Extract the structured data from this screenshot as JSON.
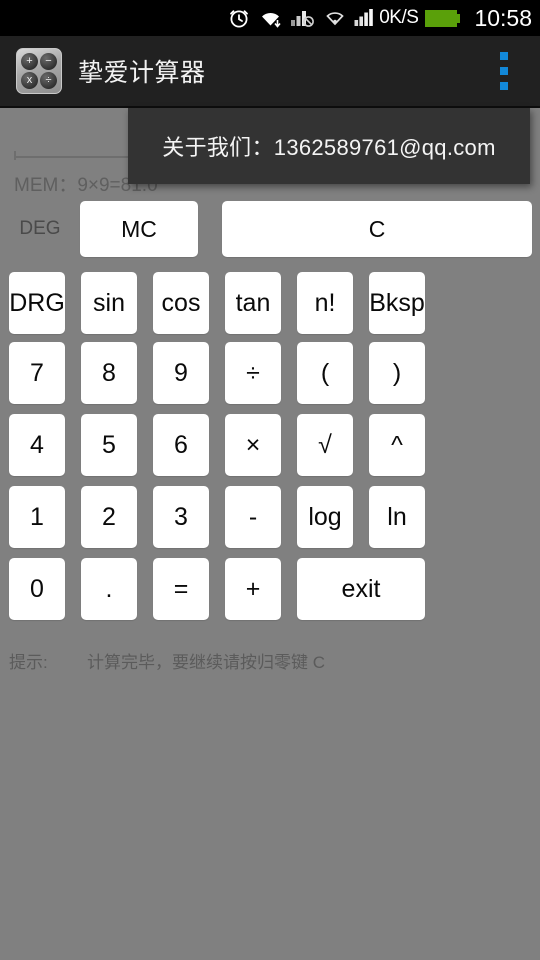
{
  "status_bar": {
    "icons": [
      "alarm-clock-icon",
      "wifi-icon",
      "signal-bars-no-sim-icon",
      "wifi-data-icon",
      "signal-bars-icon"
    ],
    "network_speed": "0K/S",
    "battery": "battery-full-icon",
    "battery_color": "#5aa00a",
    "time": "10:58"
  },
  "action_bar": {
    "app_icon": "calculator-app-icon",
    "icon_glyphs": [
      "+",
      "−",
      "x",
      "÷"
    ],
    "title": "挚爱计算器",
    "overflow": "overflow-menu-icon",
    "accent": "#1288d8"
  },
  "popup": {
    "text": "关于我们：1362589761@qq.com"
  },
  "display": {
    "value": "",
    "placeholder": "",
    "memory_line": "MEM：9×9=81.0"
  },
  "mode": {
    "angle_label": "DEG"
  },
  "top_keys": [
    {
      "label": "MC",
      "name": "memory-clear-button"
    },
    {
      "label": "C",
      "name": "clear-button"
    }
  ],
  "keypad": {
    "rows": [
      [
        {
          "label": "DRG",
          "name": "drg-button",
          "tall": true
        },
        {
          "label": "sin",
          "name": "sin-button"
        },
        {
          "label": "cos",
          "name": "cos-button"
        },
        {
          "label": "tan",
          "name": "tan-button"
        },
        {
          "label": "n!",
          "name": "factorial-button"
        },
        {
          "label": "Bksp",
          "name": "backspace-button",
          "tall": true
        }
      ],
      [
        {
          "label": "7",
          "name": "digit-7-button"
        },
        {
          "label": "8",
          "name": "digit-8-button"
        },
        {
          "label": "9",
          "name": "digit-9-button"
        },
        {
          "label": "÷",
          "name": "divide-button"
        },
        {
          "label": "(",
          "name": "open-paren-button"
        },
        {
          "label": ")",
          "name": "close-paren-button"
        }
      ],
      [
        {
          "label": "4",
          "name": "digit-4-button"
        },
        {
          "label": "5",
          "name": "digit-5-button"
        },
        {
          "label": "6",
          "name": "digit-6-button"
        },
        {
          "label": "×",
          "name": "multiply-button"
        },
        {
          "label": "√",
          "name": "sqrt-button"
        },
        {
          "label": "^",
          "name": "power-button"
        }
      ],
      [
        {
          "label": "1",
          "name": "digit-1-button"
        },
        {
          "label": "2",
          "name": "digit-2-button"
        },
        {
          "label": "3",
          "name": "digit-3-button"
        },
        {
          "label": "-",
          "name": "minus-button"
        },
        {
          "label": "log",
          "name": "log-button"
        },
        {
          "label": "ln",
          "name": "ln-button"
        }
      ],
      [
        {
          "label": "0",
          "name": "digit-0-button"
        },
        {
          "label": ".",
          "name": "decimal-point-button"
        },
        {
          "label": "=",
          "name": "equals-button"
        },
        {
          "label": "+",
          "name": "plus-button"
        },
        {
          "label": "exit",
          "name": "exit-button",
          "wide": true
        }
      ]
    ]
  },
  "hint": {
    "label": "提示:",
    "text": "计算完毕，要继续请按归零键 C"
  },
  "colors": {
    "background": "#808080",
    "action_bar": "#212121",
    "key_face": "#ffffff",
    "popup_bg": "#333333"
  }
}
